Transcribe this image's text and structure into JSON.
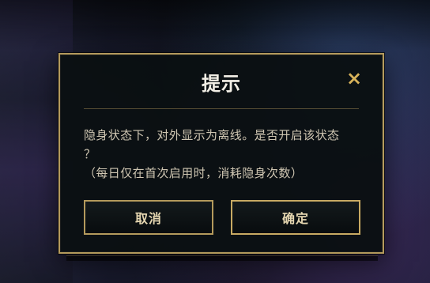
{
  "dialog": {
    "title": "提示",
    "close_icon": "×",
    "message": {
      "line1": "隐身状态下，对外显示为离线。是否开启该状态",
      "line2": "？",
      "line3": "（每日仅在首次启用时，消耗隐身次数）"
    },
    "buttons": {
      "cancel": "取消",
      "confirm": "确定"
    }
  },
  "colors": {
    "accent_gold": "#b49a5c",
    "text_light": "#f3efe6",
    "text_muted": "#cfc6b2",
    "button_text": "#e6d7b1",
    "close_icon": "#d8b35a"
  }
}
